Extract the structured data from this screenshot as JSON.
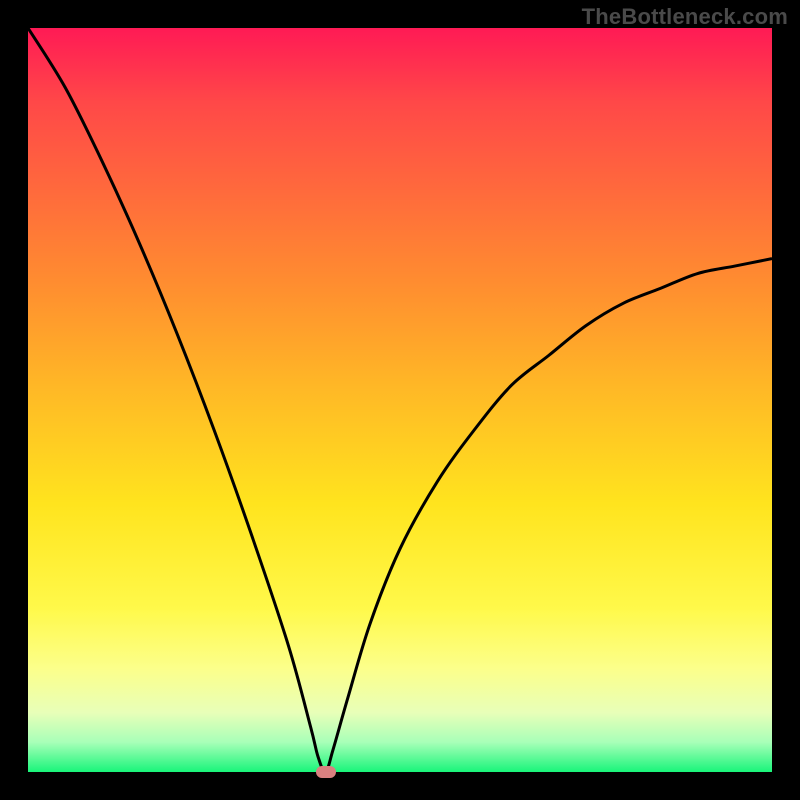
{
  "watermark": "TheBottleneck.com",
  "chart_data": {
    "type": "line",
    "title": "",
    "xlabel": "",
    "ylabel": "",
    "xlim": [
      0,
      100
    ],
    "ylim": [
      0,
      100
    ],
    "grid": false,
    "series": [
      {
        "name": "curve",
        "x": [
          0,
          5,
          10,
          15,
          20,
          25,
          30,
          35,
          38,
          39,
          40,
          41,
          43,
          46,
          50,
          55,
          60,
          65,
          70,
          75,
          80,
          85,
          90,
          95,
          100
        ],
        "values": [
          100,
          92,
          82,
          71,
          59,
          46,
          32,
          17,
          6,
          2,
          0,
          3,
          10,
          20,
          30,
          39,
          46,
          52,
          56,
          60,
          63,
          65,
          67,
          68,
          69
        ],
        "stroke": "#000000"
      }
    ],
    "marker": {
      "x": 40,
      "y": 0,
      "color": "#d98080"
    },
    "background_gradient_stops": [
      {
        "pos": 0,
        "color": "#ff1a55"
      },
      {
        "pos": 10,
        "color": "#ff4848"
      },
      {
        "pos": 22,
        "color": "#ff6a3c"
      },
      {
        "pos": 34,
        "color": "#ff8c30"
      },
      {
        "pos": 48,
        "color": "#ffb726"
      },
      {
        "pos": 64,
        "color": "#ffe41e"
      },
      {
        "pos": 78,
        "color": "#fff94a"
      },
      {
        "pos": 86,
        "color": "#fcff8a"
      },
      {
        "pos": 92,
        "color": "#e8ffb8"
      },
      {
        "pos": 96,
        "color": "#a8ffb8"
      },
      {
        "pos": 100,
        "color": "#19f57a"
      }
    ]
  }
}
